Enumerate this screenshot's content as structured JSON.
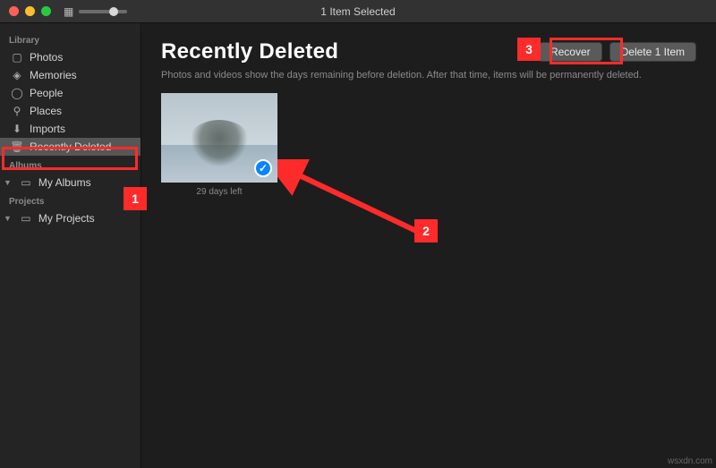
{
  "titlebar": {
    "title": "1 Item Selected"
  },
  "sidebar": {
    "section_library": "Library",
    "library_items": [
      {
        "icon": "photos-icon",
        "label": "Photos"
      },
      {
        "icon": "memories-icon",
        "label": "Memories"
      },
      {
        "icon": "people-icon",
        "label": "People"
      },
      {
        "icon": "places-icon",
        "label": "Places"
      },
      {
        "icon": "imports-icon",
        "label": "Imports"
      },
      {
        "icon": "trash-icon",
        "label": "Recently Deleted",
        "selected": true
      }
    ],
    "section_albums": "Albums",
    "my_albums_label": "My Albums",
    "section_projects": "Projects",
    "my_projects_label": "My Projects"
  },
  "header": {
    "title": "Recently Deleted",
    "recover_label": "Recover",
    "delete_label": "Delete 1 Item"
  },
  "subtitle": "Photos and videos show the days remaining before deletion. After that time, items will be permanently deleted.",
  "items": [
    {
      "caption": "29 days left",
      "selected": true
    }
  ],
  "annotations": {
    "n1": "1",
    "n2": "2",
    "n3": "3"
  },
  "watermark": "wsxdn.com"
}
